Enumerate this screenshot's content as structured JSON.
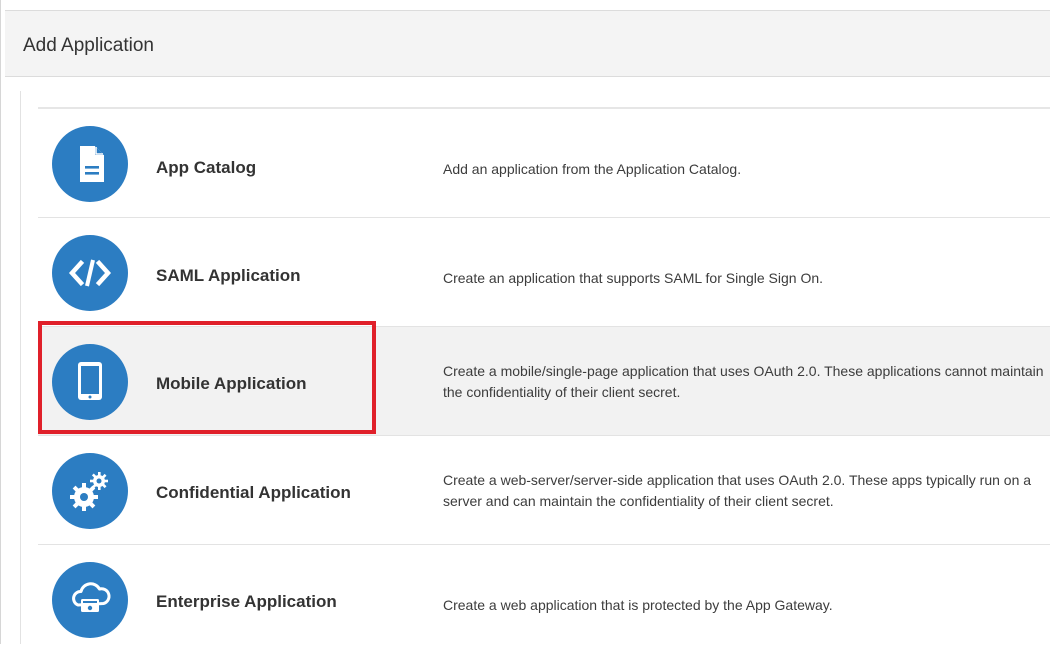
{
  "dialog": {
    "title": "Add Application"
  },
  "options": [
    {
      "id": "app-catalog",
      "name": "App Catalog",
      "description": "Add an application from the Application Catalog.",
      "icon": "document-icon",
      "selected": false
    },
    {
      "id": "saml",
      "name": "SAML Application",
      "description": "Create an application that supports SAML for Single Sign On.",
      "icon": "code-icon",
      "selected": false
    },
    {
      "id": "mobile",
      "name": "Mobile Application",
      "description": "Create a mobile/single-page application that uses OAuth 2.0. These applications cannot maintain the confidentiality of their client secret.",
      "icon": "tablet-icon",
      "selected": true
    },
    {
      "id": "confidential",
      "name": "Confidential Application",
      "description": "Create a web-server/server-side application that uses OAuth 2.0. These apps typically run on a server and can maintain the confidentiality of their client secret.",
      "icon": "gears-icon",
      "selected": false
    },
    {
      "id": "enterprise",
      "name": "Enterprise Application",
      "description": "Create a web application that is protected by the App Gateway.",
      "icon": "cloud-gateway-icon",
      "selected": false
    }
  ],
  "colors": {
    "icon_circle": "#2c7dc2",
    "highlight": "#e0202a",
    "header_bg": "#f4f4f4",
    "selected_row_bg": "#f2f2f2"
  }
}
